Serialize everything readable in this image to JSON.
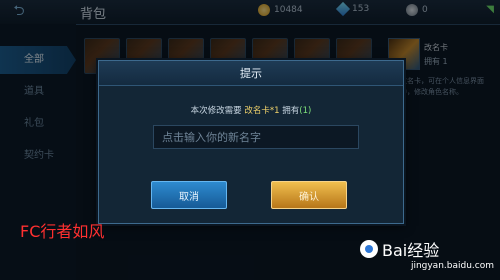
{
  "topbar": {
    "title": "背包",
    "gold": "10484",
    "diamonds": "153",
    "gems": "0"
  },
  "sidebar": {
    "items": [
      {
        "label": "全部",
        "active": true
      },
      {
        "label": "道具",
        "active": false
      },
      {
        "label": "礼包",
        "active": false
      },
      {
        "label": "契约卡",
        "active": false
      }
    ]
  },
  "detail": {
    "name": "改名卡",
    "own": "拥有 1",
    "desc": "改名卡，可在个人信息界面中，修改角色名称。"
  },
  "dialog": {
    "title": "提示",
    "msg_prefix": "本次修改需要",
    "item": "改名卡*1",
    "own_label": "拥有",
    "own_open": "(",
    "own_count": "1",
    "own_close": ")",
    "input_placeholder": "点击输入你的新名字",
    "cancel_label": "取消",
    "confirm_label": "确认"
  },
  "watermark": {
    "author": "FC行者如风",
    "baidu": "Bai经验",
    "url": "jingyan.baidu.com"
  },
  "colors": {
    "accent": "#2e8bd0",
    "confirm": "#f0bf4f",
    "highlight": "#f1d36b",
    "success": "#7ee07a"
  }
}
